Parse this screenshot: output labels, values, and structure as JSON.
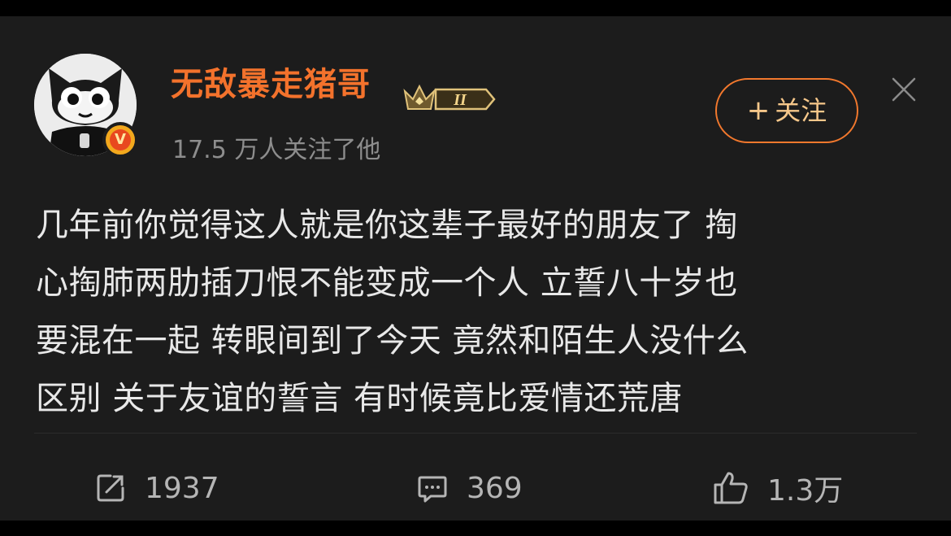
{
  "user": {
    "name": "无敌暴走猪哥",
    "followers_text": "17.5 万人关注了他",
    "level_badge": "II",
    "verified_mark": "V"
  },
  "follow_button": {
    "plus": "+",
    "label": "关注"
  },
  "post": {
    "lines": [
      "几年前你觉得这人就是你这辈子最好的朋友了 掏",
      "心掏肺两肋插刀恨不能变成一个人 立誓八十岁也",
      "要混在一起 转眼间到了今天 竟然和陌生人没什么",
      "区别 关于友谊的誓言 有时候竟比爱情还荒唐"
    ]
  },
  "actions": {
    "repost": {
      "icon": "repost-icon",
      "count": "1937"
    },
    "comment": {
      "icon": "comment-icon",
      "count": "369"
    },
    "like": {
      "icon": "like-icon",
      "count": "1.3万"
    }
  },
  "colors": {
    "background": "#000000",
    "card": "#1c1c1c",
    "username": "#f3722c",
    "follow_border": "#f2782d",
    "follow_text": "#f6c78a",
    "body_text": "#e8e8e8",
    "muted_text": "#8d8d8d"
  }
}
